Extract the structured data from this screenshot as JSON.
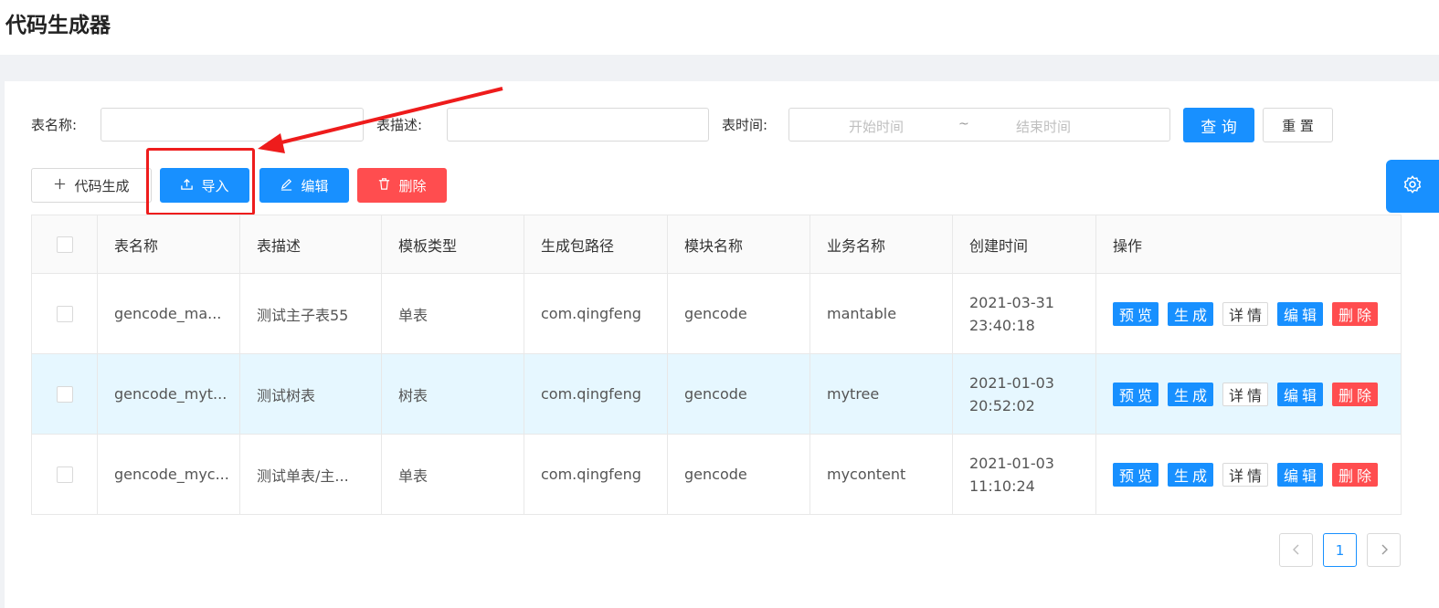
{
  "header": {
    "title": "代码生成器"
  },
  "filters": {
    "table_name_label": "表名称:",
    "table_name_value": "",
    "table_desc_label": "表描述:",
    "table_desc_value": "",
    "table_time_label": "表时间:",
    "start_placeholder": "开始时间",
    "separator": "~",
    "end_placeholder": "结束时间",
    "query_label": "查 询",
    "reset_label": "重 置"
  },
  "toolbar": {
    "generate_label": "代码生成",
    "import_label": "导入",
    "edit_label": "编辑",
    "delete_label": "删除"
  },
  "table": {
    "columns": [
      "表名称",
      "表描述",
      "模板类型",
      "生成包路径",
      "模块名称",
      "业务名称",
      "创建时间",
      "操作"
    ],
    "rows": [
      {
        "name": "gencode_ma...",
        "desc": "测试主子表55",
        "template": "单表",
        "package": "com.qingfeng",
        "module": "gencode",
        "business": "mantable",
        "date": "2021-03-31",
        "time": "23:40:18"
      },
      {
        "name": "gencode_myt...",
        "desc": "测试树表",
        "template": "树表",
        "package": "com.qingfeng",
        "module": "gencode",
        "business": "mytree",
        "date": "2021-01-03",
        "time": "20:52:02"
      },
      {
        "name": "gencode_myc...",
        "desc": "测试单表/主...",
        "template": "单表",
        "package": "com.qingfeng",
        "module": "gencode",
        "business": "mycontent",
        "date": "2021-01-03",
        "time": "11:10:24"
      }
    ],
    "actions": {
      "preview": "预览",
      "generate": "生成",
      "detail": "详情",
      "edit": "编辑",
      "delete": "删除"
    }
  },
  "pagination": {
    "current_page": "1"
  },
  "colors": {
    "primary": "#1890ff",
    "danger": "#ff4d4f",
    "highlight": "#ee1c1c",
    "selected_row": "#e6f7ff"
  },
  "icons": {
    "generate": "plus-icon",
    "import": "upload-icon",
    "edit": "edit-icon",
    "delete": "trash-icon",
    "settings": "gear-icon",
    "prev": "chevron-left-icon",
    "next": "chevron-right-icon"
  }
}
